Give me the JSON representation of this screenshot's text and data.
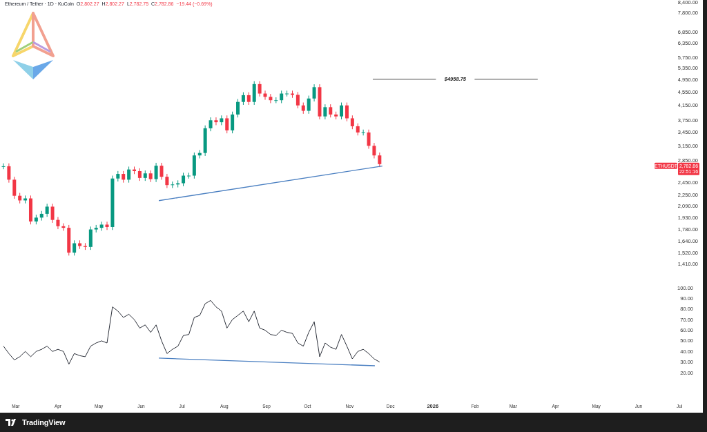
{
  "legend": {
    "symbol": "Ethereum / Tether · 1D · KuCoin",
    "ohlc": [
      {
        "label": "O",
        "value": "2,802.27"
      },
      {
        "label": "H",
        "value": "2,802.27"
      },
      {
        "label": "L",
        "value": "2,782.75"
      },
      {
        "label": "C",
        "value": "2,782.86"
      }
    ],
    "change": "−19.44 (−0.69%)"
  },
  "price_panel": {
    "level_label": "$4958.75",
    "price_tag": {
      "symbol": "ETHUSDT",
      "price": "2,782.86",
      "countdown": "22:51:16"
    },
    "axis_labels": [
      "8,400.00",
      "7,800.00",
      "6,850.00",
      "6,350.00",
      "5,750.00",
      "5,350.00",
      "4,950.00",
      "4,550.00",
      "4,150.00",
      "3,750.00",
      "3,450.00",
      "3,150.00",
      "2,850.00",
      "2,450.00",
      "2,250.00",
      "2,090.00",
      "1,930.00",
      "1,780.00",
      "1,640.00",
      "1,520.00",
      "1,410.00"
    ]
  },
  "oscillator_panel": {
    "axis_labels": [
      "100.00",
      "90.00",
      "80.00",
      "70.00",
      "60.00",
      "50.00",
      "40.00",
      "30.00",
      "20.00"
    ]
  },
  "time_axis": [
    {
      "label": "Mar",
      "kind": "month"
    },
    {
      "label": "Apr",
      "kind": "month"
    },
    {
      "label": "May",
      "kind": "month"
    },
    {
      "label": "Jun",
      "kind": "month"
    },
    {
      "label": "Jul",
      "kind": "month"
    },
    {
      "label": "Aug",
      "kind": "month"
    },
    {
      "label": "Sep",
      "kind": "month"
    },
    {
      "label": "Oct",
      "kind": "month"
    },
    {
      "label": "Nov",
      "kind": "month"
    },
    {
      "label": "Dec",
      "kind": "month"
    },
    {
      "label": "2026",
      "kind": "year"
    },
    {
      "label": "Feb",
      "kind": "month"
    },
    {
      "label": "Mar",
      "kind": "month"
    },
    {
      "label": "Apr",
      "kind": "month"
    },
    {
      "label": "May",
      "kind": "month"
    },
    {
      "label": "Jun",
      "kind": "month"
    },
    {
      "label": "Jul",
      "kind": "month"
    }
  ],
  "footer": {
    "brand": "TradingView"
  }
}
